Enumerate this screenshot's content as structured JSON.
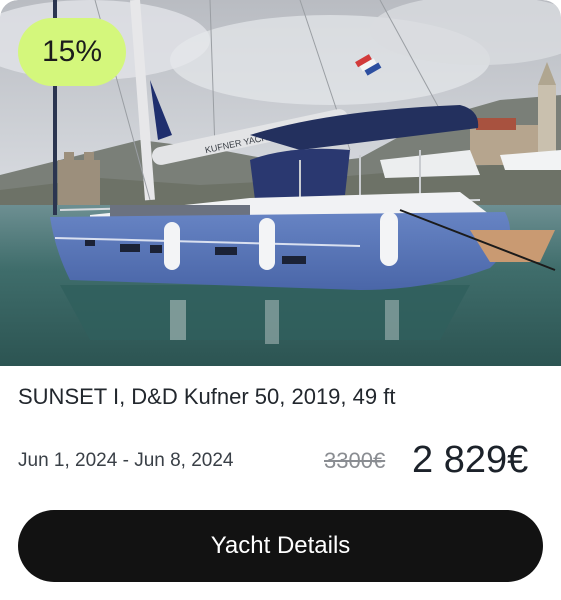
{
  "offer": {
    "discount_badge": "15%",
    "title": "SUNSET I, D&D Kufner 50, 2019, 49 ft",
    "dates": "Jun 1, 2024 - Jun 8, 2024",
    "old_price": "3300€",
    "new_price": "2 829€",
    "details_button": "Yacht Details",
    "boat_brand_text": "KUFNER YACHTS"
  },
  "colors": {
    "badge_bg": "#d4f77c",
    "button_bg": "#121212",
    "hull": "#5573b6",
    "bimini": "#23305e",
    "sea": "#3f6d6b",
    "sky": "#cfd3d8"
  }
}
